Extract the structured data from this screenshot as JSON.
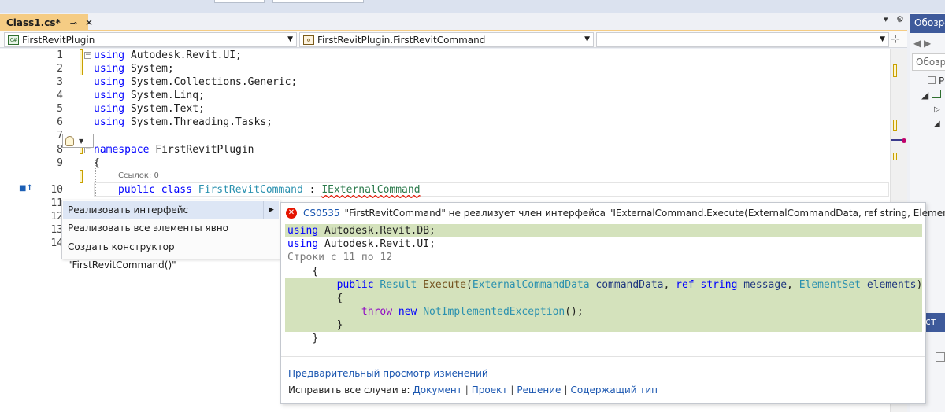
{
  "tab": {
    "title": "Class1.cs*",
    "pin_glyph": "⊸",
    "close_glyph": "✕",
    "dropdown_glyph": "▾",
    "settings_glyph": "⚙"
  },
  "navbar": {
    "project": "FirstRevitPlugin",
    "type_member": "FirstRevitPlugin.FirstRevitCommand",
    "member": "",
    "split_glyph": "⊹",
    "class_icon_text": "C#"
  },
  "editor": {
    "lines": [
      {
        "num": "1",
        "code": "Autodesk.Revit.UI;"
      },
      {
        "num": "2",
        "code": "System;"
      },
      {
        "num": "3",
        "code": "System.Collections.Generic;"
      },
      {
        "num": "4",
        "code": "System.Linq;"
      },
      {
        "num": "5",
        "code": "System.Text;"
      },
      {
        "num": "6",
        "code": "System.Threading.Tasks;"
      },
      {
        "num": "7",
        "code": ""
      },
      {
        "num": "8",
        "code": "FirstRevitPlugin"
      },
      {
        "num": "9",
        "code": "{"
      },
      {
        "num": "10",
        "code": ""
      },
      {
        "num": "11",
        "code": ""
      },
      {
        "num": "12",
        "code": ""
      },
      {
        "num": "13",
        "code": ""
      },
      {
        "num": "14",
        "code": ""
      }
    ],
    "kw_using": "using",
    "kw_namespace": "namespace",
    "codelens": "Ссылок: 0",
    "line10": {
      "kw_public": "public",
      "kw_class": "class",
      "class_name": "FirstRevitCommand",
      "colon": ":",
      "interface": "IExternalCommand"
    }
  },
  "quick_actions_menu": {
    "items": [
      "Реализовать интерфейс",
      "Реализовать все элементы явно",
      "Создать конструктор \"FirstRevitCommand()\""
    ],
    "submenu_arrow": "▶"
  },
  "preview": {
    "error_code": "CS0535",
    "error_message": "\"FirstRevitCommand\" не реализует член интерфейса \"IExternalCommand.Execute(ExternalCommandData, ref string, ElementSet)\".",
    "using1_ns": "Autodesk.Revit.DB;",
    "using2_ns": "Autodesk.Revit.UI;",
    "lines_range": "Строки с 11 по 12",
    "brace_open": "{",
    "brace_close": "}",
    "method": {
      "kw_public": "public",
      "ret_type": "Result",
      "name": "Execute",
      "p1_type": "ExternalCommandData",
      "p1_name": "commandData",
      "kw_ref": "ref",
      "kw_string": "string",
      "p2_name": "message",
      "p3_type": "ElementSet",
      "p3_name": "elements"
    },
    "kw_throw": "throw",
    "kw_new": "new",
    "exception": "NotImplementedException",
    "preview_link": "Предварительный просмотр изменений",
    "fix_all_label": "Исправить все случаи в:",
    "fix_scopes": [
      "Документ",
      "Проект",
      "Решение",
      "Содержащий тип"
    ]
  },
  "right_panel": {
    "title": "Обозре",
    "search": "Обозр",
    "tree_item": "Р",
    "bottom_title": "ойст"
  }
}
